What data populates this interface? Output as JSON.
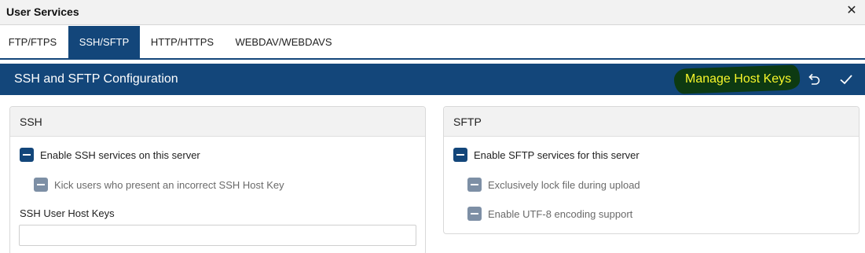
{
  "window": {
    "title": "User Services",
    "close_glyph": "✕"
  },
  "tabs": [
    {
      "label": "FTP/FTPS",
      "active": false
    },
    {
      "label": "SSH/SFTP",
      "active": true
    },
    {
      "label": "HTTP/HTTPS",
      "active": false
    },
    {
      "label": "WEBDAV/WEBDAVS",
      "active": false
    }
  ],
  "header": {
    "title": "SSH and SFTP Configuration",
    "manage_label": "Manage Host Keys",
    "undo_icon": "undo-icon",
    "save_icon": "checkmark-icon"
  },
  "ssh": {
    "title": "SSH",
    "enable_label": "Enable SSH services on this server",
    "enable_checked": true,
    "kick_label": "Kick users who present an incorrect SSH Host Key",
    "kick_checked": true,
    "host_keys_label": "SSH User Host Keys",
    "host_keys_value": ""
  },
  "sftp": {
    "title": "SFTP",
    "enable_label": "Enable SFTP services for this server",
    "enable_checked": true,
    "lock_label": "Exclusively lock file during upload",
    "lock_checked": true,
    "utf8_label": "Enable UTF-8 encoding support",
    "utf8_checked": true
  },
  "colors": {
    "primary": "#13467a",
    "highlight_text": "#f7f72a",
    "highlight_marker": "#0d3a12",
    "disabled_checkbox": "#7d8fa5"
  }
}
